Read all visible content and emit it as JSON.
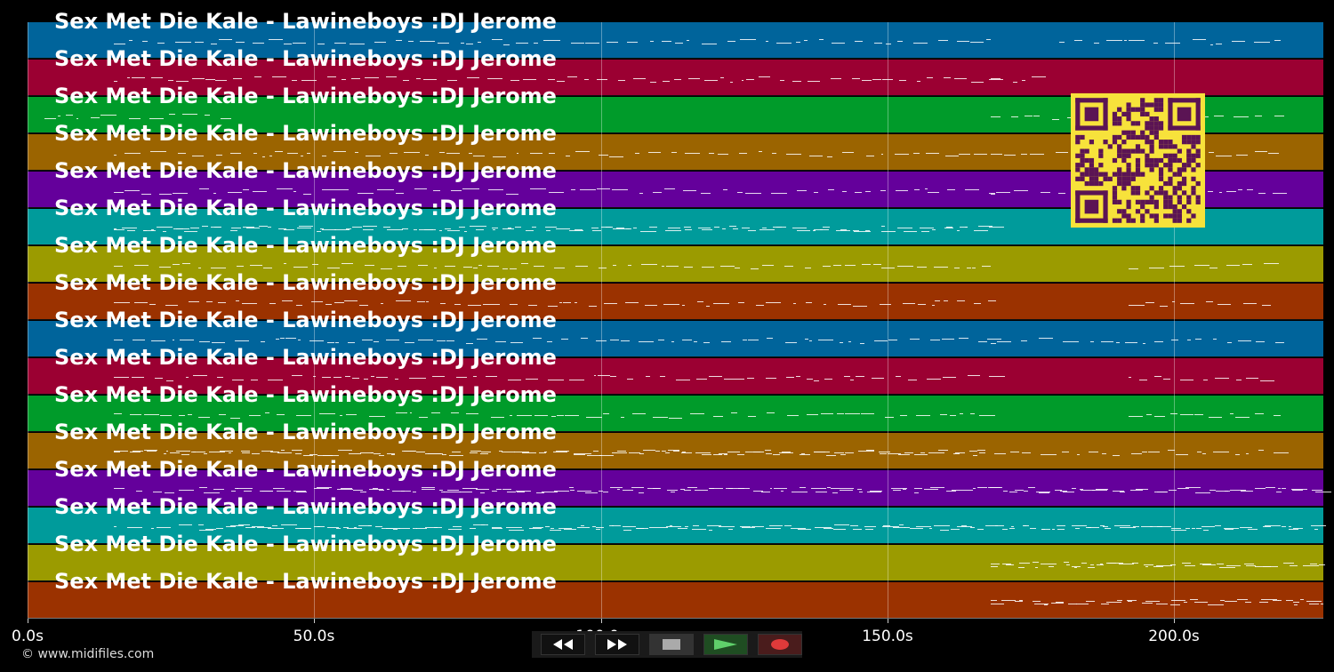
{
  "track_title": "Sex Met Die Kale - Lawineboys :DJ Jerome",
  "track_colors": [
    "#00649b",
    "#9b0032",
    "#009b2a",
    "#9b6400",
    "#64009b",
    "#009b9b",
    "#9b9b00",
    "#9b3200",
    "#00649b",
    "#9b0032",
    "#009b2a",
    "#9b6400",
    "#64009b",
    "#009b9b",
    "#9b9b00",
    "#9b3200"
  ],
  "timeline": {
    "x_unit": "s",
    "ticks": [
      {
        "value": 0,
        "label": "0.0s"
      },
      {
        "value": 50,
        "label": "50.0s"
      },
      {
        "value": 100,
        "label": "100.0s"
      },
      {
        "value": 150,
        "label": "150.0s"
      },
      {
        "value": 200,
        "label": "200.0s"
      }
    ],
    "range": [
      0,
      226
    ]
  },
  "copyright": "© www.midifiles.com",
  "controls": [
    {
      "name": "rewind-button",
      "icon": "rewind-icon"
    },
    {
      "name": "fast-forward-button",
      "icon": "fast-forward-icon"
    },
    {
      "name": "stop-button",
      "icon": "stop-icon"
    },
    {
      "name": "play-button",
      "icon": "play-icon"
    },
    {
      "name": "record-button",
      "icon": "record-icon"
    }
  ],
  "qr_icon": "qr-code-icon"
}
